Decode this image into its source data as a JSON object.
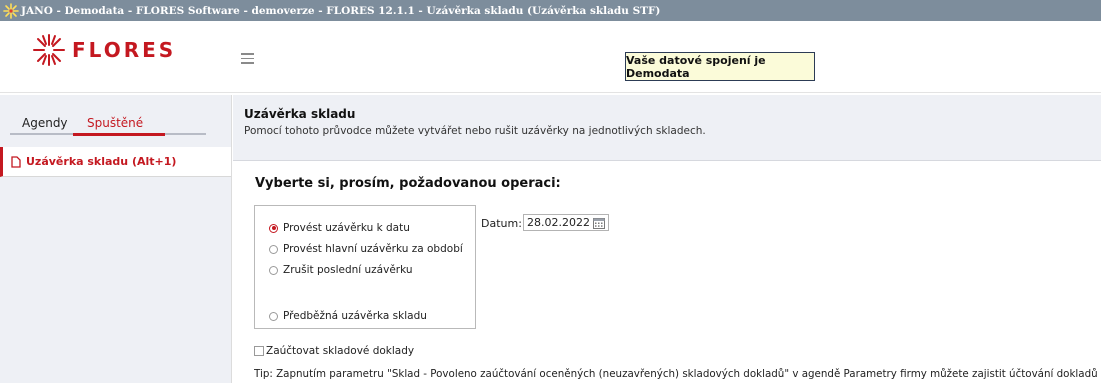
{
  "window": {
    "title": "JANO - Demodata - FLORES Software - demoverze - FLORES 12.1.1 - Uzávěrka skladu  (Uzávěrka skladu STF)"
  },
  "header": {
    "logo_text": "FLORES",
    "connection_notice": "Vaše datové spojení je Demodata"
  },
  "sidebar": {
    "tabs": [
      {
        "label": "Agendy",
        "active": false
      },
      {
        "label": "Spuštěné",
        "active": true
      }
    ],
    "items": [
      {
        "label": "Uzávěrka skladu (Alt+1)",
        "icon": "document-icon"
      }
    ]
  },
  "main": {
    "title": "Uzávěrka skladu",
    "description": "Pomocí tohoto průvodce můžete vytvářet nebo rušit uzávěrky na jednotlivých skladech.",
    "operation_heading": "Vyberte si, prosím, požadovanou operaci:",
    "options": [
      {
        "label": "Provést uzávěrku k datu",
        "selected": true
      },
      {
        "label": "Provést hlavní uzávěrku za období",
        "selected": false
      },
      {
        "label": "Zrušit poslední uzávěrku",
        "selected": false
      },
      {
        "label": "Předběžná uzávěrka skladu",
        "selected": false
      }
    ],
    "date_label": "Datum:",
    "date_value": "28.02.2022",
    "checkbox_label": "Zaúčtovat skladové doklady",
    "checkbox_checked": false,
    "tip": "Tip: Zapnutím parametru \"Sklad - Povoleno zaúčtování oceněných (neuzavřených) skladových dokladů\" v agendě Parametry firmy můžete zajistit účtování dokladů ihned po jejich ocenění."
  },
  "colors": {
    "accent": "#c41820",
    "titlebar": "#7d8d9c",
    "panel": "#eef0f5",
    "notice_bg": "#fbfbd9"
  }
}
